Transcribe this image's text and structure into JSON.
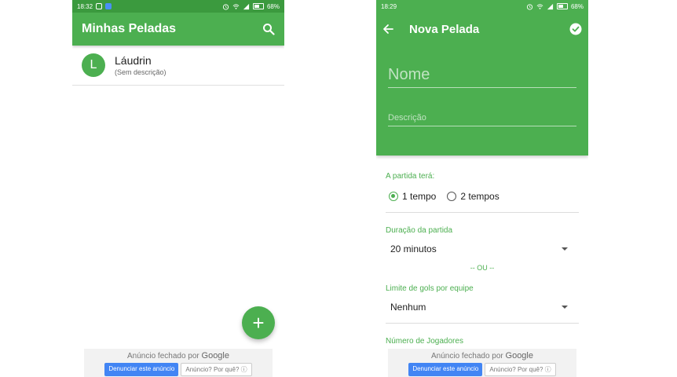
{
  "left": {
    "status": {
      "time": "18:32",
      "battery": "68%"
    },
    "appbar": {
      "title": "Minhas Peladas"
    },
    "items": [
      {
        "initial": "L",
        "title": "Láudrin",
        "subtitle": "(Sem descrição)"
      }
    ],
    "fab": "+",
    "ad": {
      "text": "Anúncio fechado por",
      "brand": "Google",
      "report": "Denunciar este anúncio",
      "why": "Anúncio? Por quê? ⓘ"
    }
  },
  "right": {
    "status": {
      "time": "18:29",
      "battery": "68%"
    },
    "toolbar": {
      "title": "Nova Pelada"
    },
    "name_placeholder": "Nome",
    "desc_placeholder": "Descrição",
    "match_label": "A partida terá:",
    "option1": "1 tempo",
    "option2": "2 tempos",
    "duration_label": "Duração da partida",
    "duration_value": "20 minutos",
    "or_text": "-- OU --",
    "goals_label": "Limite de gols por equipe",
    "goals_value": "Nenhum",
    "players_label": "Número de Jogadores",
    "ad": {
      "text": "Anúncio fechado por",
      "brand": "Google",
      "report": "Denunciar este anúncio",
      "why": "Anúncio? Por quê? ⓘ"
    }
  },
  "colors": {
    "primary": "#4caf50",
    "status": "#3b9a3e",
    "ad_button": "#4285f4"
  },
  "icons": [
    "search-icon",
    "back-arrow-icon",
    "check-circle-icon",
    "wifi-icon",
    "signal-icon",
    "alarm-icon",
    "battery-icon"
  ]
}
